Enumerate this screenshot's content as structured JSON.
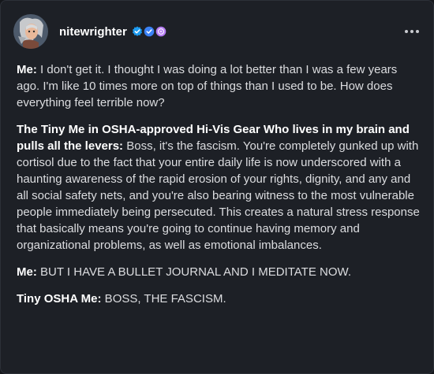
{
  "post": {
    "username": "nitewrighter",
    "badges": [
      "verified-badge-icon",
      "blue-check-badge-icon",
      "purple-badge-icon"
    ],
    "more_label": "More options",
    "paragraphs": [
      {
        "speaker": "Me:",
        "text": " I don't get it. I thought I was doing a lot better than I was a few years ago. I'm like 10 times more on top of things than I used to be. How does everything feel terrible now?"
      },
      {
        "speaker": "The Tiny Me in OSHA-approved Hi-Vis Gear Who lives in my brain and pulls all the levers:",
        "text": " Boss, it's the fascism. You're completely gunked up with cortisol due to the fact that your entire daily life is now underscored with a haunting awareness of the rapid erosion of your rights, dignity, and any and all social safety nets, and you're also bearing witness to the most vulnerable people immediately being persecuted. This creates a natural stress response that basically means you're going to continue having memory and organizational problems, as well as emotional imbalances."
      },
      {
        "speaker": "Me:",
        "text": " BUT I HAVE A BULLET JOURNAL AND I MEDITATE NOW."
      },
      {
        "speaker": "Tiny OSHA Me:",
        "text": " BOSS, THE FASCISM."
      }
    ]
  },
  "colors": {
    "background": "#1d2026",
    "text": "#dcdde0",
    "verified_blue": "#1d9bf0",
    "badge_purple": "#b57cf2"
  }
}
